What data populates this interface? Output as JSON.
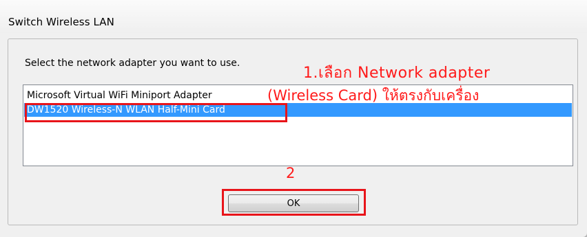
{
  "window": {
    "title": "Switch Wireless LAN"
  },
  "prompt": "Select the network adapter you want to use.",
  "adapters": [
    {
      "label": "Microsoft Virtual WiFi Miniport Adapter",
      "selected": false
    },
    {
      "label": "DW1520 Wireless-N WLAN Half-Mini Card",
      "selected": true
    }
  ],
  "ok_label": "OK",
  "annotations": {
    "step1_line1": "1.เลือก Network adapter",
    "step1_line2": "(Wireless  Card) ให้ตรงกับเครื่อง",
    "step2": "2"
  },
  "colors": {
    "selection": "#3399ff",
    "annotation": "#e8141a"
  }
}
